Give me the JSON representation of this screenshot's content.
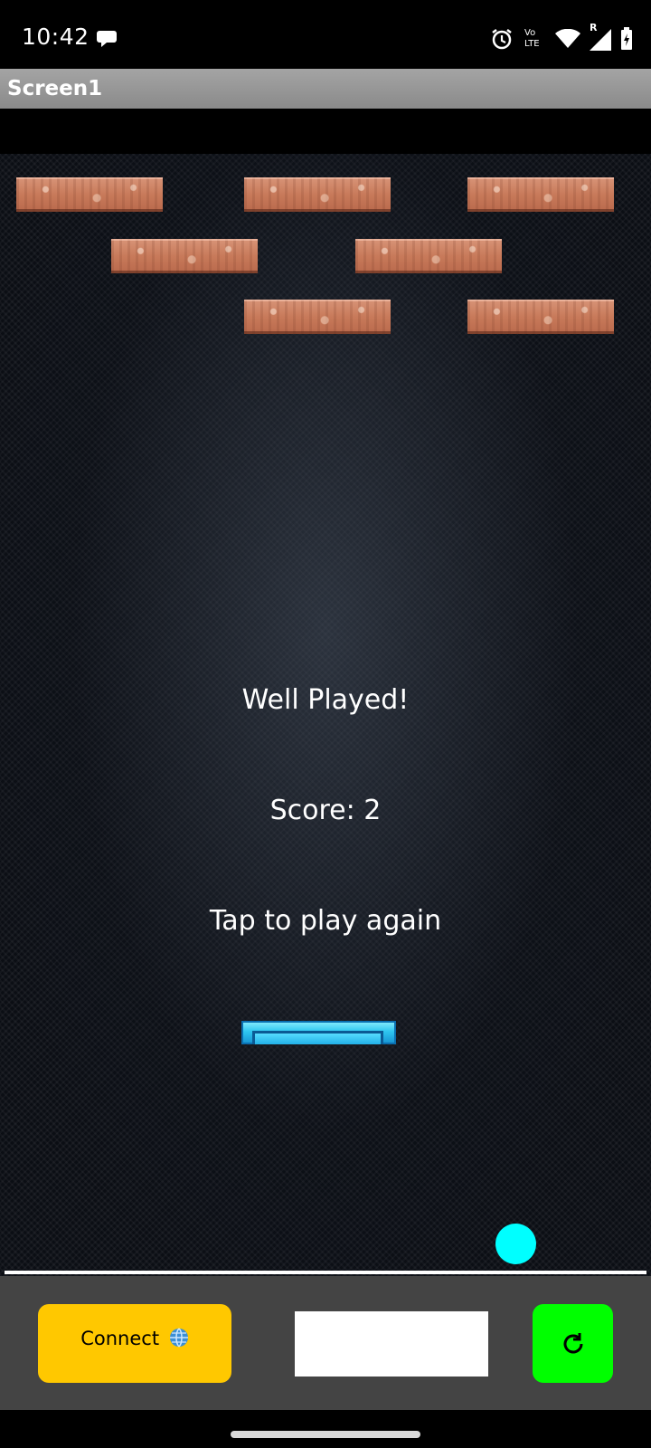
{
  "status_bar": {
    "time": "10:42",
    "icons": [
      "chat-bubble-icon",
      "alarm-icon",
      "volte-icon",
      "wifi-icon",
      "signal-icon",
      "battery-charging-icon"
    ],
    "network_label_top": "Vo",
    "network_label_bottom": "LTE",
    "roaming_label": "R"
  },
  "app_bar": {
    "title": "Screen1"
  },
  "game": {
    "bricks_remaining": 7,
    "message_line1": "Well Played!",
    "message_line2": "Score: 2",
    "message_line3": "Tap  to play again",
    "score": 2,
    "colors": {
      "ball": "#00ffff",
      "paddle": "#2ec6f0",
      "brick": "#c9805f"
    }
  },
  "controls": {
    "connect_label": "Connect",
    "connect_icon": "globe-icon",
    "text_box_value": "",
    "refresh_icon": "refresh-icon",
    "colors": {
      "connect": "#ffc800",
      "refresh": "#00ff00",
      "bar": "#444444"
    }
  }
}
